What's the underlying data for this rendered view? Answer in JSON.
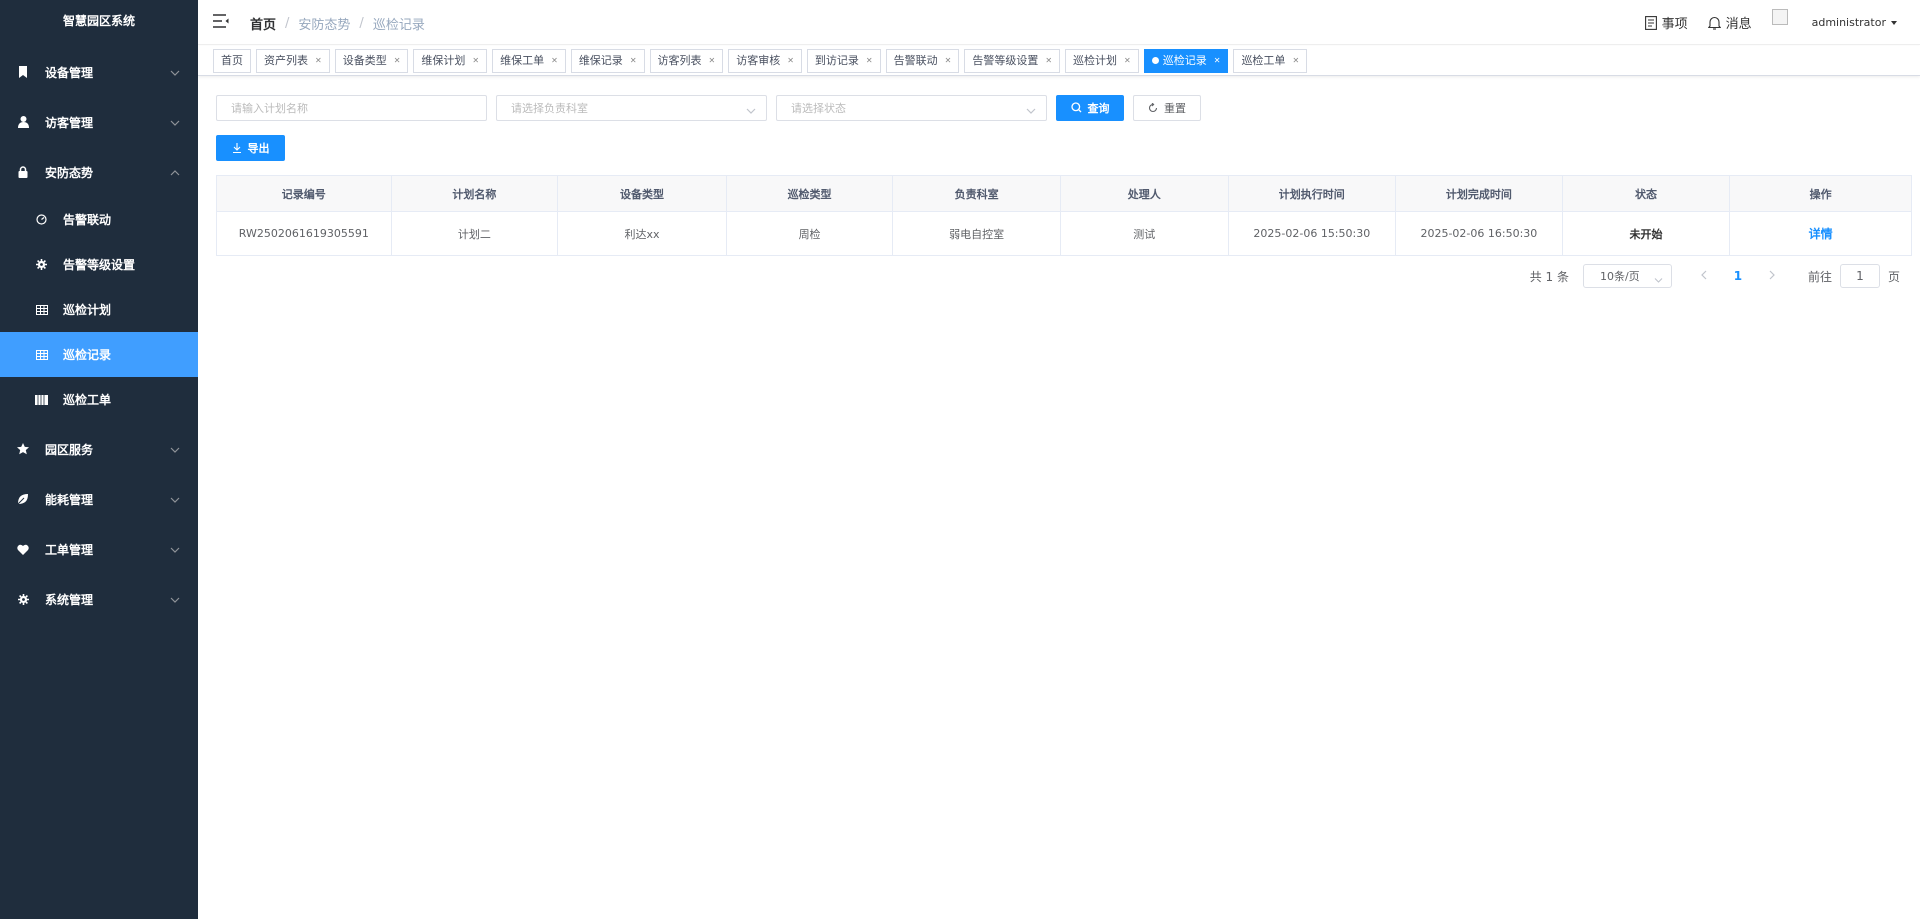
{
  "app": {
    "title": "智慧园区系统"
  },
  "sidebar": {
    "items": [
      {
        "label": "设备管理",
        "icon": "bookmark-icon"
      },
      {
        "label": "访客管理",
        "icon": "user-icon"
      },
      {
        "label": "安防态势",
        "icon": "lock-icon",
        "expanded": true,
        "children": [
          {
            "label": "告警联动",
            "icon": "dashboard-icon"
          },
          {
            "label": "告警等级设置",
            "icon": "gear-icon"
          },
          {
            "label": "巡检计划",
            "icon": "table-icon"
          },
          {
            "label": "巡检记录",
            "icon": "table-icon",
            "active": true
          },
          {
            "label": "巡检工单",
            "icon": "list-icon"
          }
        ]
      },
      {
        "label": "园区服务",
        "icon": "star-icon"
      },
      {
        "label": "能耗管理",
        "icon": "leaf-icon"
      },
      {
        "label": "工单管理",
        "icon": "heart-icon"
      },
      {
        "label": "系统管理",
        "icon": "gear-icon"
      }
    ]
  },
  "header": {
    "breadcrumb": [
      "首页",
      "安防态势",
      "巡检记录"
    ],
    "todo_label": "事项",
    "message_label": "消息",
    "user": "administrator"
  },
  "tags": [
    {
      "label": "首页",
      "closable": false
    },
    {
      "label": "资产列表",
      "closable": true
    },
    {
      "label": "设备类型",
      "closable": true
    },
    {
      "label": "维保计划",
      "closable": true
    },
    {
      "label": "维保工单",
      "closable": true
    },
    {
      "label": "维保记录",
      "closable": true
    },
    {
      "label": "访客列表",
      "closable": true
    },
    {
      "label": "访客审核",
      "closable": true
    },
    {
      "label": "到访记录",
      "closable": true
    },
    {
      "label": "告警联动",
      "closable": true
    },
    {
      "label": "告警等级设置",
      "closable": true
    },
    {
      "label": "巡检计划",
      "closable": true
    },
    {
      "label": "巡检记录",
      "closable": true,
      "active": true
    },
    {
      "label": "巡检工单",
      "closable": true
    }
  ],
  "filters": {
    "plan_name_placeholder": "请输入计划名称",
    "department_placeholder": "请选择负责科室",
    "status_placeholder": "请选择状态",
    "search_label": "查询",
    "reset_label": "重置",
    "export_label": "导出"
  },
  "table": {
    "columns": [
      "记录编号",
      "计划名称",
      "设备类型",
      "巡检类型",
      "负责科室",
      "处理人",
      "计划执行时间",
      "计划完成时间",
      "状态",
      "操作"
    ],
    "rows": [
      {
        "record_no": "RW2502061619305591",
        "plan_name": "计划二",
        "device_type": "利达xx",
        "inspection_type": "周检",
        "department": "弱电自控室",
        "handler": "测试",
        "start_time": "2025-02-06 15:50:30",
        "end_time": "2025-02-06 16:50:30",
        "status": "未开始",
        "action": "详情"
      }
    ]
  },
  "pagination": {
    "total_text": "共 1 条",
    "page_size": "10条/页",
    "current_page": "1",
    "goto_label": "前往",
    "goto_value": "1",
    "page_suffix": "页"
  },
  "colors": {
    "sidebar_bg": "#1f2d3d",
    "accent": "#1890ff",
    "active_menu": "#409eff"
  }
}
